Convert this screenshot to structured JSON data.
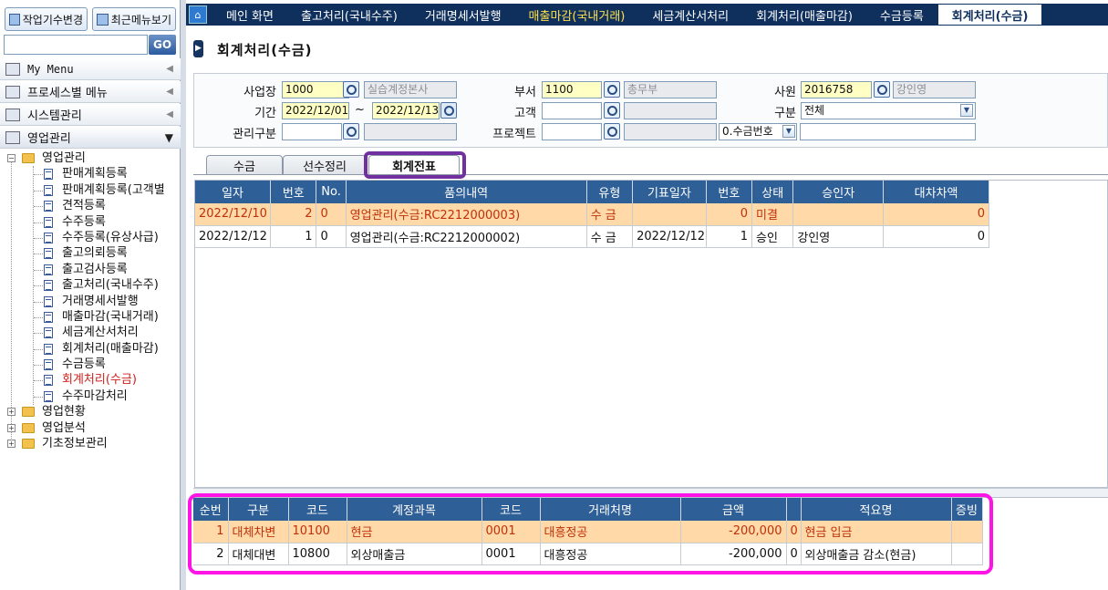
{
  "sidebar": {
    "btn_work": "작업기수변경",
    "btn_recent": "최근메뉴보기",
    "search_placeholder": "",
    "go": "GO",
    "menus": [
      "My Menu",
      "프로세스별 메뉴",
      "시스템관리",
      "영업관리"
    ],
    "tree_root": "영업관리",
    "tree_items": [
      "판매계획등록",
      "판매계획등록(고객별",
      "견적등록",
      "수주등록",
      "수주등록(유상사급)",
      "출고의뢰등록",
      "출고검사등록",
      "출고처리(국내수주)",
      "거래명세서발행",
      "매출마감(국내거래)",
      "세금계산서처리",
      "회계처리(매출마감)",
      "수금등록",
      "회계처리(수금)",
      "수주마감처리"
    ],
    "tree_groups": [
      "영업현황",
      "영업분석",
      "기초정보관리"
    ]
  },
  "top_tabs": [
    {
      "label": "메인 화면",
      "style": "normal"
    },
    {
      "label": "출고처리(국내수주)",
      "style": "normal"
    },
    {
      "label": "거래명세서발행",
      "style": "normal"
    },
    {
      "label": "매출마감(국내거래)",
      "style": "yellow"
    },
    {
      "label": "세금계산서처리",
      "style": "normal"
    },
    {
      "label": "회계처리(매출마감)",
      "style": "normal"
    },
    {
      "label": "수금등록",
      "style": "normal"
    },
    {
      "label": "회계처리(수금)",
      "style": "active"
    }
  ],
  "page_title": "회계처리(수금)",
  "form": {
    "site_label": "사업장",
    "site_code": "1000",
    "site_name": "실습계정본사",
    "dept_label": "부서",
    "dept_code": "1100",
    "dept_name": "총무부",
    "emp_label": "사원",
    "emp_code": "2016758",
    "emp_name": "강인영",
    "period_label": "기간",
    "date_from": "2022/12/01",
    "tilde": "~",
    "date_to": "2022/12/13",
    "customer_label": "고객",
    "customer_code": "",
    "customer_name": "",
    "type_label": "구분",
    "type_value": "전체",
    "mgmt_label": "관리구분",
    "mgmt_code": "",
    "mgmt_name": "",
    "project_label": "프로젝트",
    "project_code": "",
    "project_name": "",
    "receipt_select": "0.수금번호",
    "receipt_value": ""
  },
  "sub_tabs": [
    "수금",
    "선수정리",
    "회계전표"
  ],
  "grid1": {
    "headers": [
      "일자",
      "번호",
      "No.",
      "품의내역",
      "유형",
      "기표일자",
      "번호",
      "상태",
      "승인자",
      "대차차액"
    ],
    "rows": [
      [
        "2022/12/10",
        "2",
        "0",
        "영업관리(수금:RC2212000003)",
        "수  금",
        "",
        "0",
        "미결",
        "",
        "0"
      ],
      [
        "2022/12/12",
        "1",
        "0",
        "영업관리(수금:RC2212000002)",
        "수  금",
        "2022/12/12",
        "1",
        "승인",
        "강인영",
        "0"
      ]
    ]
  },
  "grid2": {
    "headers": [
      "순번",
      "구분",
      "코드",
      "계정과목",
      "코드",
      "거래처명",
      "금액",
      "",
      "적요명",
      "증빙"
    ],
    "rows": [
      [
        "1",
        "대체차변",
        "10100",
        "현금",
        "0001",
        "대흥정공",
        "-200,000",
        "0",
        "현금 입금",
        ""
      ],
      [
        "2",
        "대체대변",
        "10800",
        "외상매출금",
        "0001",
        "대흥정공",
        "-200,000",
        "0",
        "외상매출금 감소(현금)",
        ""
      ]
    ]
  },
  "colors": {
    "header_bg": "#2f5f97",
    "selected_row": "#ffd9a8",
    "highlight_tab": "#7030a0",
    "highlight_grid": "#ff14e6"
  }
}
